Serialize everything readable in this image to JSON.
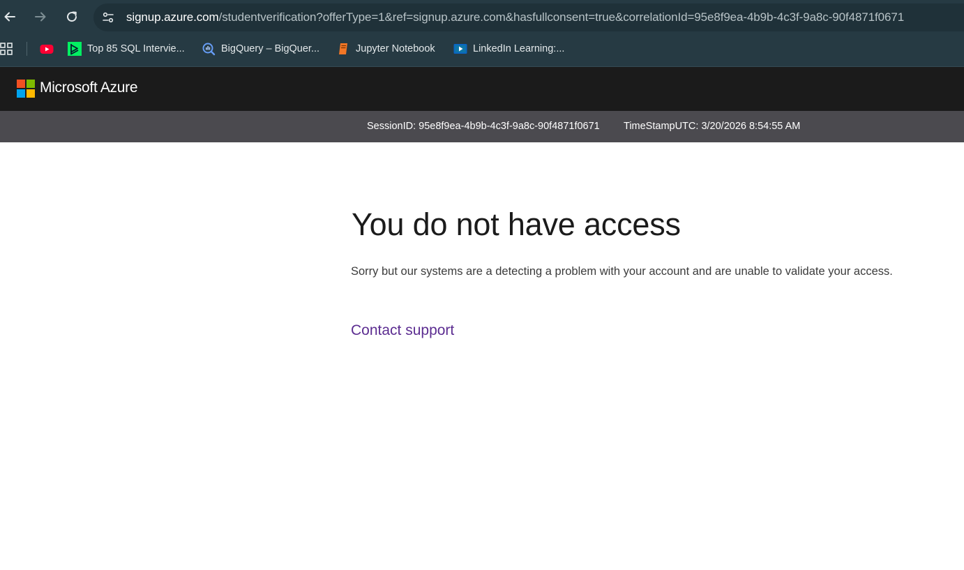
{
  "browser": {
    "url_host": "signup.azure.com",
    "url_rest": "/studentverification?offerType=1&ref=signup.azure.com&hasfullconsent=true&correlationId=95e8f9ea-4b9b-4c3f-9a8c-90f4871f0671",
    "nav_icons": [
      "back-arrow-icon",
      "forward-arrow-icon",
      "reload-icon",
      "site-info-icon"
    ],
    "bookmarks": [
      {
        "label": "",
        "icon": "youtube-icon",
        "color": "#ff0033"
      },
      {
        "label": "Top 85 SQL Intervie...",
        "icon": "datacamp-icon",
        "color": "#03ef62"
      },
      {
        "label": "BigQuery – BigQuer...",
        "icon": "bigquery-icon",
        "color": "#669df6"
      },
      {
        "label": "Jupyter Notebook",
        "icon": "notebook-icon",
        "color": "#f37726"
      },
      {
        "label": "LinkedIn Learning:...",
        "icon": "linkedin-learning-icon",
        "color": "#0a66c2"
      }
    ]
  },
  "header": {
    "brand": "Microsoft Azure",
    "logo_colors": [
      "#f25022",
      "#7fba00",
      "#00a4ef",
      "#ffb900"
    ]
  },
  "session": {
    "session_id": "SessionID: 95e8f9ea-4b9b-4c3f-9a8c-90f4871f0671",
    "timestamp": "TimeStampUTC: 3/20/2026 8:54:55 AM"
  },
  "content": {
    "title": "You do not have access",
    "message": "Sorry but our systems are a detecting a problem with your account and are unable to validate your access.",
    "support_link": "Contact support"
  },
  "colors": {
    "chrome_bg": "#263a43",
    "header_bg": "#1b1b1b",
    "session_bg": "#4b4a4f",
    "link": "#5c2d91"
  }
}
